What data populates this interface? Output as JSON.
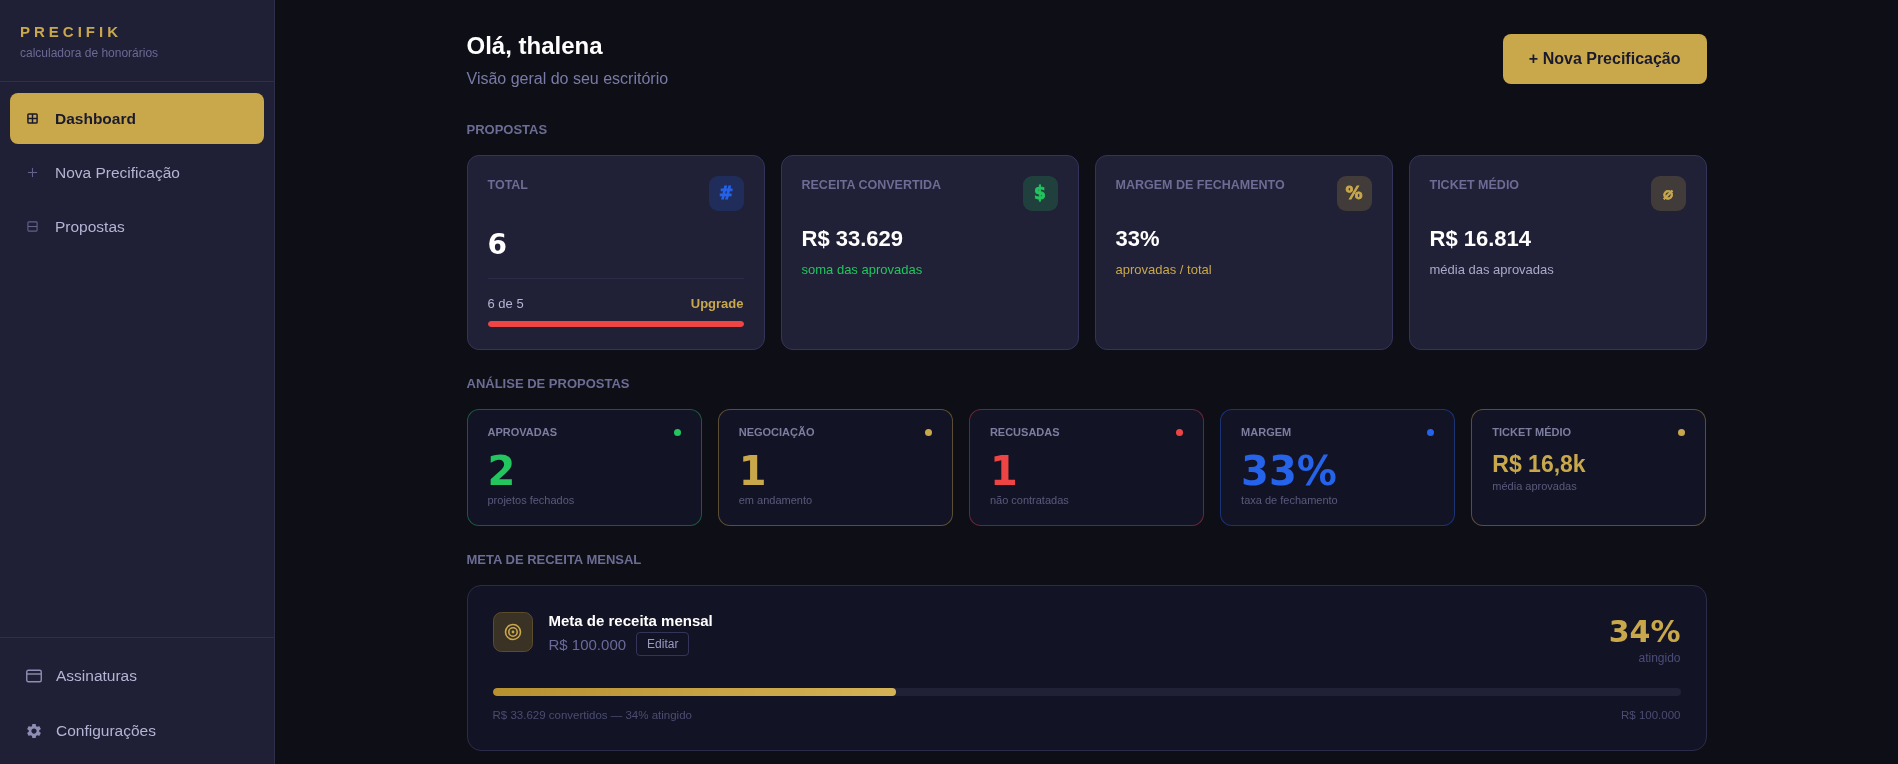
{
  "sidebar": {
    "brand": "PRECIFIK",
    "tagline": "calculadora de honorários",
    "nav": [
      {
        "label": "Dashboard",
        "selected": true
      },
      {
        "label": "Nova Precificação",
        "selected": false
      },
      {
        "label": "Propostas",
        "selected": false
      }
    ],
    "footer_nav": [
      {
        "label": "Assinaturas",
        "selected": false
      },
      {
        "label": "Configurações",
        "selected": false
      }
    ]
  },
  "header": {
    "title": "Olá, thalena",
    "subtitle": "Visão geral do seu escritório",
    "action": "+ Nova Precificação"
  },
  "proposals": {
    "heading": "PROPOSTAS",
    "cards": [
      {
        "kind": "usage",
        "label": "TOTAL",
        "symbol": "#",
        "color": "#2563eb",
        "value": "6",
        "usage": {
          "text": "6 de 5",
          "link": "Upgrade",
          "level": 1,
          "over_limit": true
        }
      },
      {
        "kind": "metric",
        "label": "RECEITA CONVERTIDA",
        "symbol": "$",
        "color": "#22c55e",
        "value": "R$ 33.629",
        "note": {
          "text": "soma das aprovadas",
          "accent": true
        }
      },
      {
        "kind": "metric",
        "label": "MARGEM DE FECHAMENTO",
        "symbol": "%",
        "color": "#c9a84c",
        "value": "33%",
        "note": {
          "text": "aprovadas / total",
          "accent": true
        }
      },
      {
        "kind": "metric",
        "label": "TICKET MÉDIO",
        "symbol": "⌀",
        "color": "#c9a84c",
        "value": "R$ 16.814",
        "note": {
          "text": "média das aprovadas",
          "accent": false
        }
      }
    ]
  },
  "analysis": {
    "heading": "ANÁLISE DE PROPOSTAS",
    "items": [
      {
        "kind": "number",
        "label": "APROVADAS",
        "value": "2",
        "note": "projetos fechados",
        "color": "#22c55e"
      },
      {
        "kind": "number",
        "label": "NEGOCIAÇÃO",
        "value": "1",
        "note": "em andamento",
        "color": "#c9a84c"
      },
      {
        "kind": "number",
        "label": "RECUSADAS",
        "value": "1",
        "note": "não contratadas",
        "color": "#ef4444"
      },
      {
        "kind": "number",
        "label": "MARGEM",
        "value": "33%",
        "note": "taxa de fechamento",
        "color": "#2563eb"
      },
      {
        "kind": "money",
        "label": "TICKET MÉDIO",
        "value": "R$ 16,8k",
        "note": "média aprovadas",
        "color": "#c9a84c"
      }
    ]
  },
  "goal": {
    "heading": "META DE RECEITA MENSAL",
    "title": "Meta de receita mensal",
    "amount": "R$ 100.000",
    "edit": "Editar",
    "percent": "34%",
    "percent_label": "atingido",
    "level": 0.34,
    "progress_text": "R$ 33.629 convertidos — 34% atingido",
    "target_text": "R$ 100.000"
  }
}
